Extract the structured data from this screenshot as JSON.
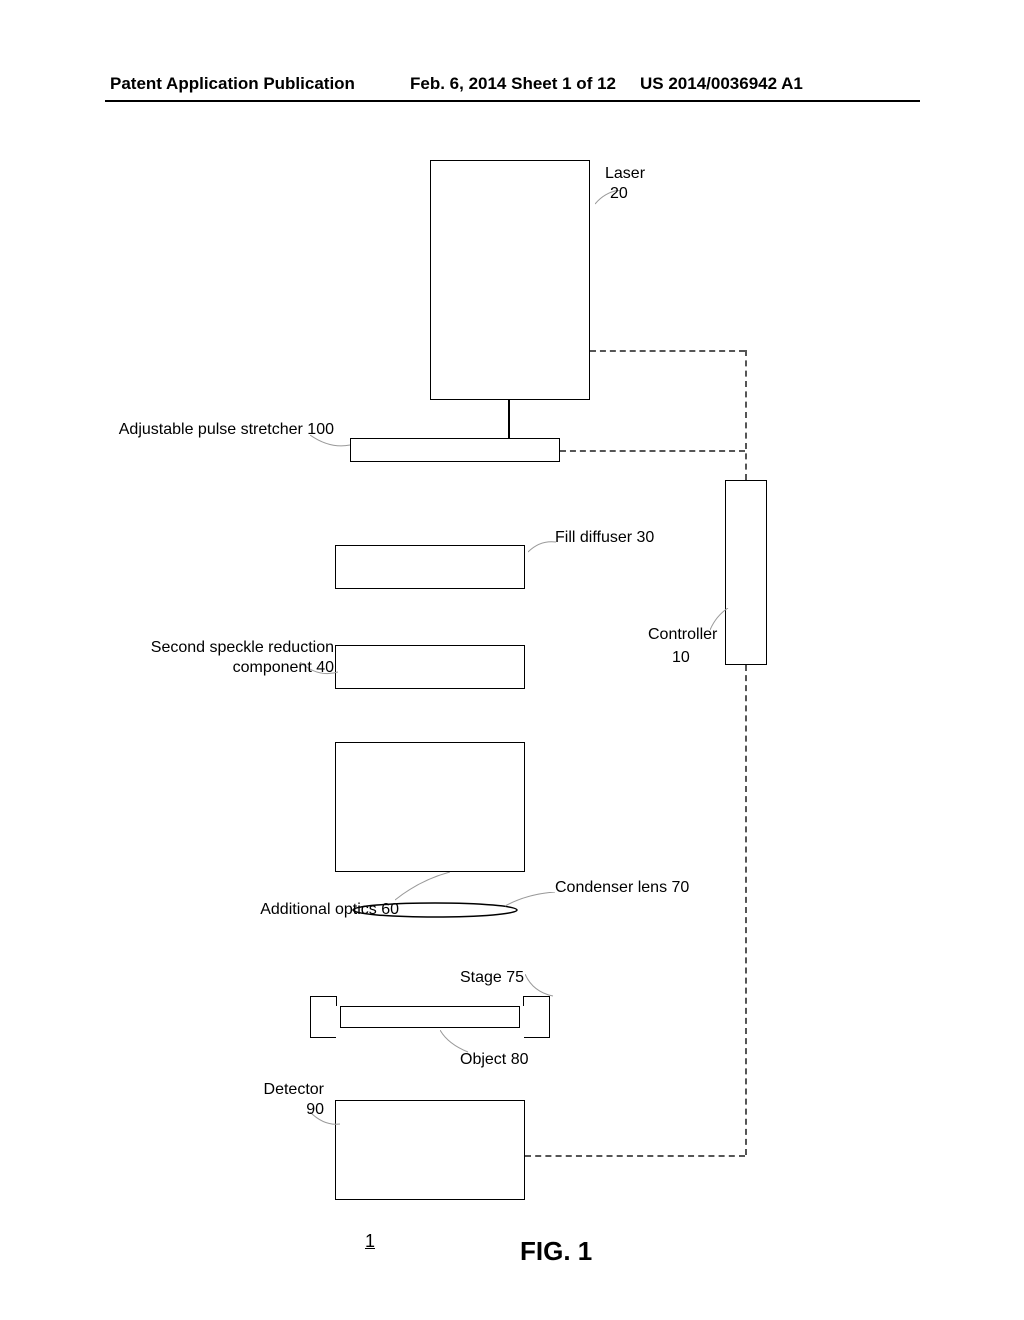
{
  "header": {
    "left": "Patent Application Publication",
    "center": "Feb. 6, 2014   Sheet 1 of 12",
    "right": "US 2014/0036942 A1"
  },
  "labels": {
    "laser_name": "Laser",
    "laser_ref": "20",
    "pulse_stretcher": "Adjustable pulse stretcher 100",
    "fill_diffuser": "Fill diffuser 30",
    "speckle_line1": "Second speckle reduction",
    "speckle_line2": "component 40",
    "controller_name": "Controller",
    "controller_ref": "10",
    "condenser_lens": "Condenser lens 70",
    "additional_optics": "Additional optics 60",
    "stage": "Stage 75",
    "object": "Object 80",
    "detector_name": "Detector",
    "detector_ref": "90",
    "system_ref": "1",
    "figure": "FIG. 1"
  }
}
